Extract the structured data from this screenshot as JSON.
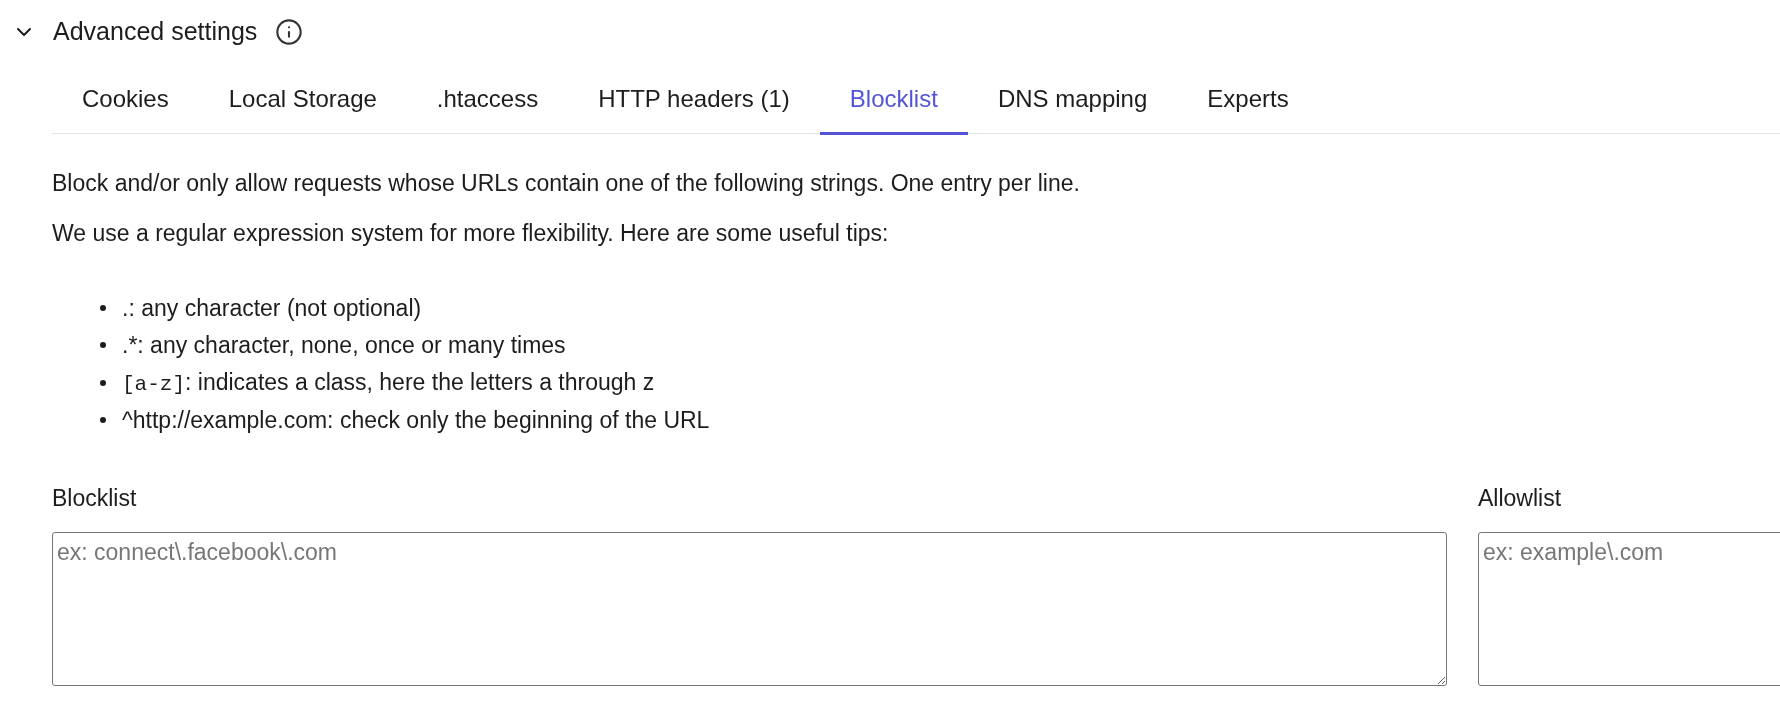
{
  "section": {
    "title": "Advanced settings",
    "expanded": true
  },
  "tabs": [
    {
      "label": "Cookies",
      "selected": false
    },
    {
      "label": "Local Storage",
      "selected": false
    },
    {
      "label": ".htaccess",
      "selected": false
    },
    {
      "label": "HTTP headers (1)",
      "selected": false
    },
    {
      "label": "Blocklist",
      "selected": true
    },
    {
      "label": "DNS mapping",
      "selected": false
    },
    {
      "label": "Experts",
      "selected": false
    }
  ],
  "description": [
    "Block and/or only allow requests whose URLs contain one of the following strings. One entry per line.",
    "We use a regular expression system for more flexibility. Here are some useful tips:"
  ],
  "tips": [
    {
      "kind": "plain",
      "text": ".: any character (not optional)"
    },
    {
      "kind": "plain",
      "text": ".*: any character, none, once or many times"
    },
    {
      "kind": "code",
      "code": "[a-z]",
      "text": ": indicates a class, here the letters a through z"
    },
    {
      "kind": "plain",
      "text": "^http://example.com: check only the beginning of the URL"
    }
  ],
  "fields": [
    {
      "label": "Blocklist",
      "placeholder": "ex: connect\\.facebook\\.com"
    },
    {
      "label": "Allowlist",
      "placeholder": "ex: example\\.com"
    }
  ]
}
